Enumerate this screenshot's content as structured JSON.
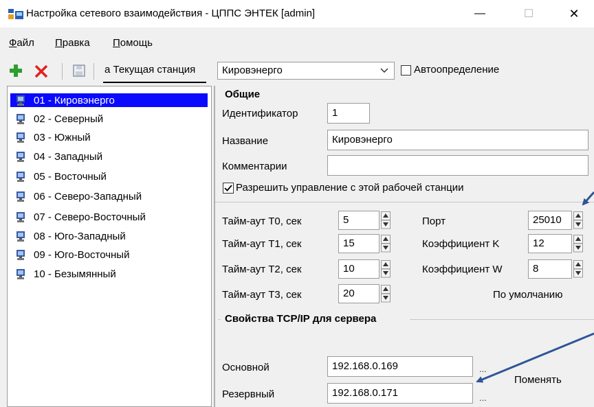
{
  "window": {
    "title": "Настройка сетевого взаимодействия - ЦППС ЭНТЕК [admin]",
    "minimize_glyph": "—",
    "maximize_glyph": "☐",
    "close_glyph": "✕"
  },
  "menu": {
    "file_first": "Ф",
    "file_rest": "айл",
    "edit_first": "П",
    "edit_rest": "равка",
    "help_first": "П",
    "help_rest": "омощь"
  },
  "toolbar": {
    "station_label": "а Текущая станция",
    "station_value": "Кировэнерго",
    "autodetect_label": "Автоопределение",
    "icons": [
      "add-icon",
      "delete-icon",
      "save-icon"
    ]
  },
  "stations": [
    "01 - Кировэнерго",
    "02 - Северный",
    "03 - Южный",
    "04 - Западный",
    "05 - Восточный",
    "06 - Северо-Западный",
    "07 - Северо-Восточный",
    "08 - Юго-Западный",
    "09 - Юго-Восточный",
    "10 - Безымянный"
  ],
  "general": {
    "title": "Общие",
    "id_label": "Идентификатор",
    "id_value": "1",
    "name_label": "Название",
    "name_value": "Кировэнерго",
    "comment_label": "Комментарии",
    "comment_value": "",
    "allow_control_label": "Разрешить управление с этой рабочей станции",
    "allow_control_checked": true
  },
  "timeouts": {
    "t0_label": "Тайм-аут Т0, сек",
    "t0_value": "5",
    "t1_label": "Тайм-аут Т1, сек",
    "t1_value": "15",
    "t2_label": "Тайм-аут Т2, сек",
    "t2_value": "10",
    "t3_label": "Тайм-аут Т3, сек",
    "t3_value": "20",
    "port_label": "Порт",
    "port_value": "25010",
    "k_label": "Коэффициент K",
    "k_value": "12",
    "w_label": "Коэффициент W",
    "w_value": "8",
    "defaults_label": "По умолчанию"
  },
  "tcpip": {
    "title": "Свойства TCP/IP для сервера",
    "primary_label": "Основной",
    "primary_value": "192.168.0.169",
    "backup_label": "Резервный",
    "backup_value": "192.168.0.171",
    "browse_glyph": "...",
    "change_annotation": "Поменять"
  },
  "colors": {
    "selection": "#0a0aff",
    "annotation_arrow": "#2f5597",
    "add_icon": "#2e9e2e",
    "delete_icon": "#e02020"
  }
}
